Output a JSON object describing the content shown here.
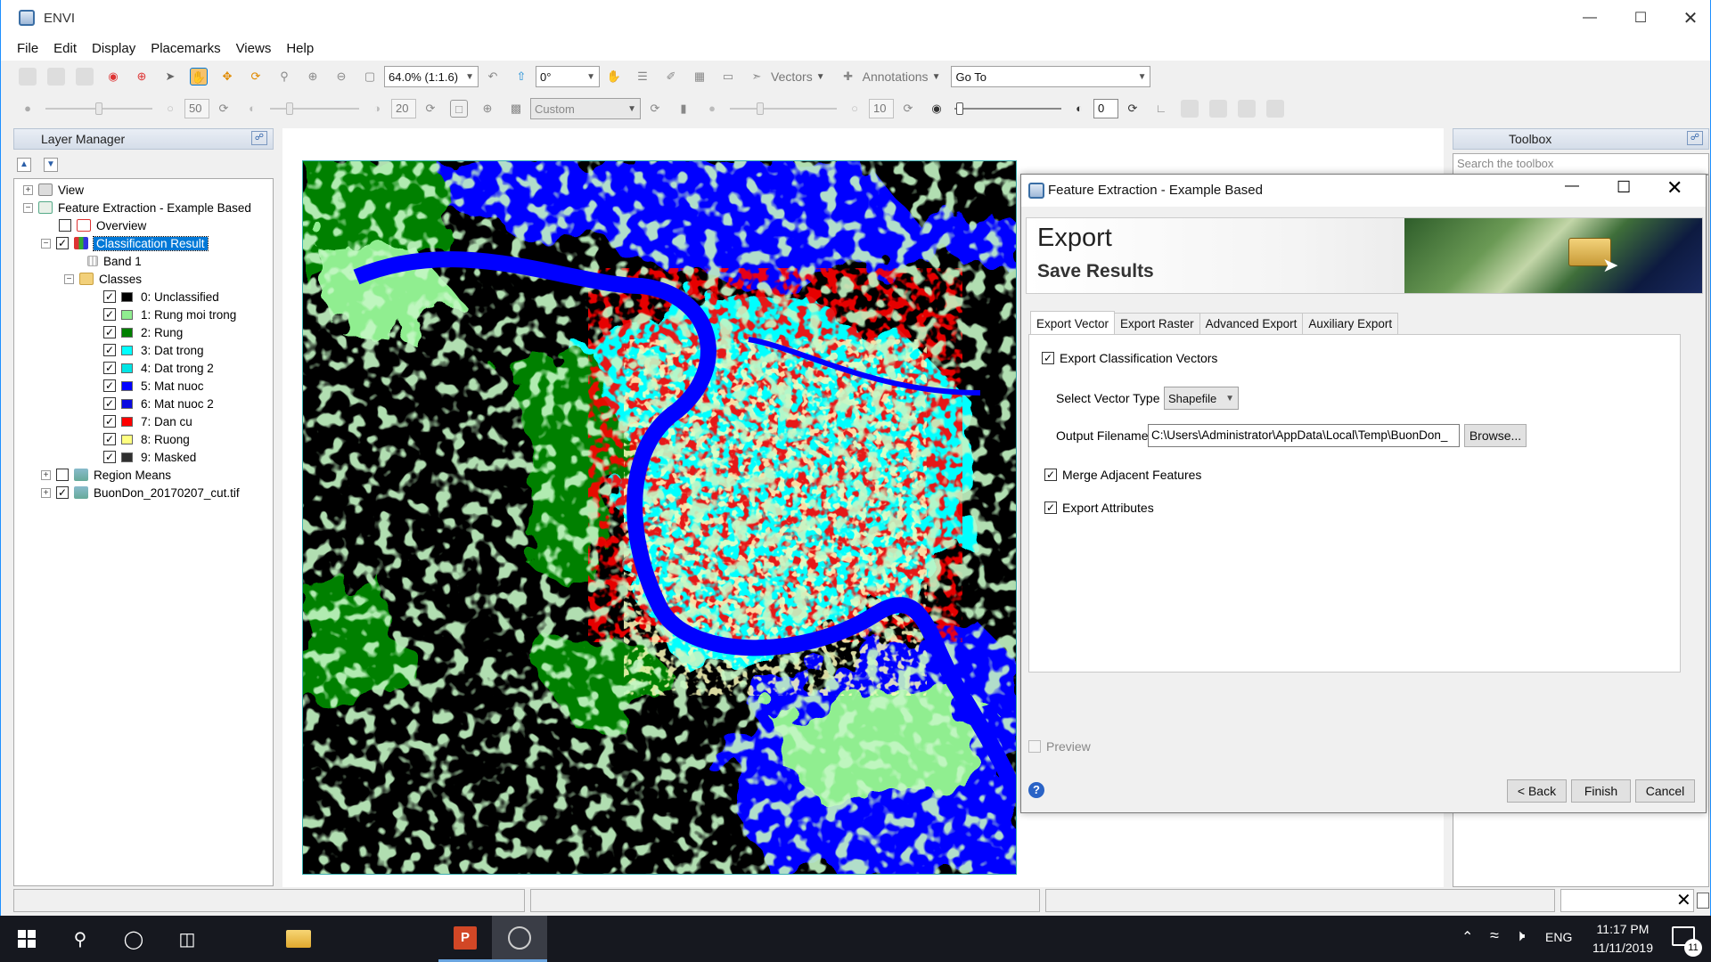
{
  "app": {
    "title": "ENVI"
  },
  "menu": [
    "File",
    "Edit",
    "Display",
    "Placemarks",
    "Views",
    "Help"
  ],
  "toolbar1": {
    "zoom_value": "64.0% (1:1.6)",
    "rotation_value": "0°",
    "vectors_label": "Vectors",
    "annotations_label": "Annotations",
    "goto_value": "Go To"
  },
  "toolbar2": {
    "brightness_value": "50",
    "contrast_value": "20",
    "stretch_value": "Custom",
    "sharpen_value": "10",
    "transparency_value": "0"
  },
  "layer_manager": {
    "title": "Layer Manager",
    "items": {
      "view": "View",
      "feature": "Feature Extraction - Example Based",
      "overview": "Overview",
      "classification": "Classification Result",
      "band": "Band 1",
      "classes": "Classes",
      "region_means": "Region Means",
      "raster": "BuonDon_20170207_cut.tif"
    },
    "class_list": [
      {
        "label": "0: Unclassified",
        "color": "#000000"
      },
      {
        "label": "1: Rung moi trong",
        "color": "#90ee90"
      },
      {
        "label": "2: Rung",
        "color": "#008000"
      },
      {
        "label": "3: Dat trong",
        "color": "#00ffff"
      },
      {
        "label": "4: Dat trong 2",
        "color": "#00e5e5"
      },
      {
        "label": "5: Mat nuoc",
        "color": "#0000ff"
      },
      {
        "label": "6: Mat nuoc 2",
        "color": "#0a0ae0"
      },
      {
        "label": "7: Dan cu",
        "color": "#ff0000"
      },
      {
        "label": "8: Ruong",
        "color": "#ffff80"
      },
      {
        "label": "9: Masked",
        "color": "#303030"
      }
    ]
  },
  "toolbox": {
    "title": "Toolbox",
    "search_placeholder": "Search the toolbox"
  },
  "dialog": {
    "title": "Feature Extraction - Example Based",
    "heading": "Export",
    "subheading": "Save Results",
    "tabs": [
      "Export Vector",
      "Export Raster",
      "Advanced Export",
      "Auxiliary Export"
    ],
    "export_vectors_label": "Export Classification Vectors",
    "vector_type_label": "Select Vector Type",
    "vector_type_value": "Shapefile",
    "output_label": "Output Filename:",
    "output_value": "C:\\Users\\Administrator\\AppData\\Local\\Temp\\BuonDon_",
    "browse_label": "Browse...",
    "merge_label": "Merge Adjacent Features",
    "attributes_label": "Export Attributes",
    "preview_label": "Preview",
    "back_label": "< Back",
    "finish_label": "Finish",
    "cancel_label": "Cancel"
  },
  "taskbar": {
    "time": "11:17 PM",
    "date": "11/11/2019",
    "lang": "ENG",
    "notif_count": "11"
  },
  "colors": {
    "accent": "#0078d7",
    "water": "#0000ff",
    "forest": "#008000",
    "urban": "#ff0000",
    "cyan": "#00ffff",
    "light_green": "#90ee90"
  }
}
